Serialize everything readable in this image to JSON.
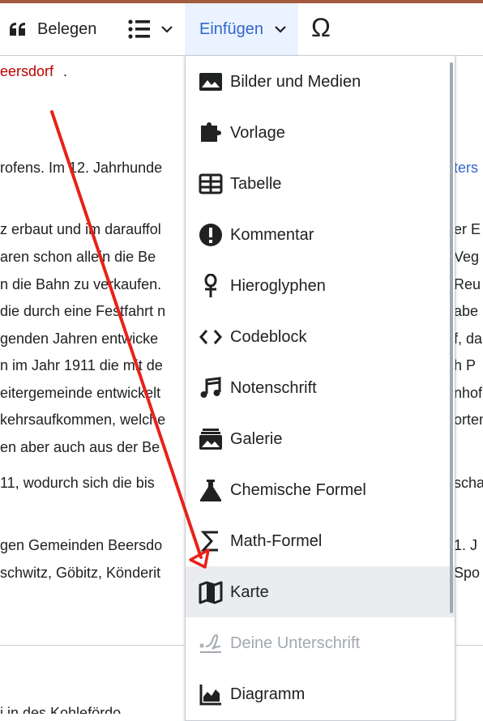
{
  "toolbar": {
    "cite_label": "Belegen",
    "insert_label": "Einfügen",
    "special_char_label": "Ω"
  },
  "article": {
    "lines": [
      "eersdorf",
      ".",
      "rofens. Im 12. Jahrhunde",
      "ters",
      "z erbaut und im darauffol",
      "er E",
      "aren schon allein die Be",
      "Veg",
      "n die Bahn zu verkaufen.",
      "Reu",
      "die durch eine Festfahrt n",
      "abe",
      "genden Jahren entwicke",
      "f, da",
      "n im Jahr 1911 die mit de",
      "h P",
      "eitergemeinde entwickelt",
      "nhof",
      "kehrsaufkommen, welche",
      "orten",
      "en aber auch aus der Be",
      "11, wodurch sich die bis",
      "scha",
      "gen Gemeinden Beersdo",
      "1. J",
      "schwitz, Göbitz, Könderit",
      "Spo",
      "i  in  des  Kohlefördo"
    ]
  },
  "insert_menu": {
    "items": [
      {
        "label": "Bilder und Medien",
        "icon": "image-icon"
      },
      {
        "label": "Vorlage",
        "icon": "puzzle-icon"
      },
      {
        "label": "Tabelle",
        "icon": "table-icon"
      },
      {
        "label": "Kommentar",
        "icon": "exclamation-icon"
      },
      {
        "label": "Hieroglyphen",
        "icon": "ankh-icon"
      },
      {
        "label": "Codeblock",
        "icon": "code-icon"
      },
      {
        "label": "Notenschrift",
        "icon": "music-note-icon"
      },
      {
        "label": "Galerie",
        "icon": "gallery-icon"
      },
      {
        "label": "Chemische Formel",
        "icon": "flask-icon"
      },
      {
        "label": "Math-Formel",
        "icon": "sigma-icon"
      },
      {
        "label": "Karte",
        "icon": "map-icon",
        "highlighted": true
      },
      {
        "label": "Deine Unterschrift",
        "icon": "signature-icon",
        "disabled": true
      },
      {
        "label": "Diagramm",
        "icon": "chart-icon"
      }
    ]
  },
  "colors": {
    "accent": "#3366cc",
    "link_red": "#ba0000",
    "hover_bg": "#eaecf0",
    "insert_bg": "#eaf3ff",
    "annotation_arrow": "#e8221b"
  }
}
